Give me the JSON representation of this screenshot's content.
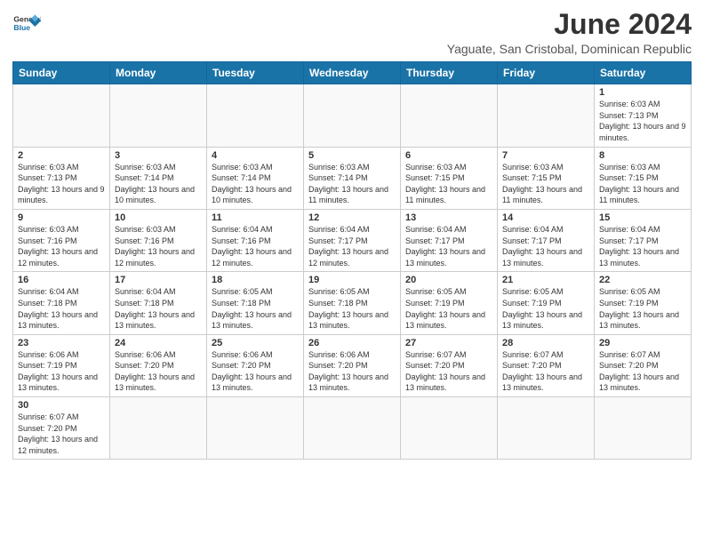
{
  "header": {
    "logo_general": "General",
    "logo_blue": "Blue",
    "month_title": "June 2024",
    "subtitle": "Yaguate, San Cristobal, Dominican Republic"
  },
  "days_of_week": [
    "Sunday",
    "Monday",
    "Tuesday",
    "Wednesday",
    "Thursday",
    "Friday",
    "Saturday"
  ],
  "weeks": [
    [
      {
        "day": "",
        "info": ""
      },
      {
        "day": "",
        "info": ""
      },
      {
        "day": "",
        "info": ""
      },
      {
        "day": "",
        "info": ""
      },
      {
        "day": "",
        "info": ""
      },
      {
        "day": "",
        "info": ""
      },
      {
        "day": "1",
        "info": "Sunrise: 6:03 AM\nSunset: 7:13 PM\nDaylight: 13 hours and 9 minutes."
      }
    ],
    [
      {
        "day": "2",
        "info": "Sunrise: 6:03 AM\nSunset: 7:13 PM\nDaylight: 13 hours and 9 minutes."
      },
      {
        "day": "3",
        "info": "Sunrise: 6:03 AM\nSunset: 7:14 PM\nDaylight: 13 hours and 10 minutes."
      },
      {
        "day": "4",
        "info": "Sunrise: 6:03 AM\nSunset: 7:14 PM\nDaylight: 13 hours and 10 minutes."
      },
      {
        "day": "5",
        "info": "Sunrise: 6:03 AM\nSunset: 7:14 PM\nDaylight: 13 hours and 11 minutes."
      },
      {
        "day": "6",
        "info": "Sunrise: 6:03 AM\nSunset: 7:15 PM\nDaylight: 13 hours and 11 minutes."
      },
      {
        "day": "7",
        "info": "Sunrise: 6:03 AM\nSunset: 7:15 PM\nDaylight: 13 hours and 11 minutes."
      },
      {
        "day": "8",
        "info": "Sunrise: 6:03 AM\nSunset: 7:15 PM\nDaylight: 13 hours and 11 minutes."
      }
    ],
    [
      {
        "day": "9",
        "info": "Sunrise: 6:03 AM\nSunset: 7:16 PM\nDaylight: 13 hours and 12 minutes."
      },
      {
        "day": "10",
        "info": "Sunrise: 6:03 AM\nSunset: 7:16 PM\nDaylight: 13 hours and 12 minutes."
      },
      {
        "day": "11",
        "info": "Sunrise: 6:04 AM\nSunset: 7:16 PM\nDaylight: 13 hours and 12 minutes."
      },
      {
        "day": "12",
        "info": "Sunrise: 6:04 AM\nSunset: 7:17 PM\nDaylight: 13 hours and 12 minutes."
      },
      {
        "day": "13",
        "info": "Sunrise: 6:04 AM\nSunset: 7:17 PM\nDaylight: 13 hours and 13 minutes."
      },
      {
        "day": "14",
        "info": "Sunrise: 6:04 AM\nSunset: 7:17 PM\nDaylight: 13 hours and 13 minutes."
      },
      {
        "day": "15",
        "info": "Sunrise: 6:04 AM\nSunset: 7:17 PM\nDaylight: 13 hours and 13 minutes."
      }
    ],
    [
      {
        "day": "16",
        "info": "Sunrise: 6:04 AM\nSunset: 7:18 PM\nDaylight: 13 hours and 13 minutes."
      },
      {
        "day": "17",
        "info": "Sunrise: 6:04 AM\nSunset: 7:18 PM\nDaylight: 13 hours and 13 minutes."
      },
      {
        "day": "18",
        "info": "Sunrise: 6:05 AM\nSunset: 7:18 PM\nDaylight: 13 hours and 13 minutes."
      },
      {
        "day": "19",
        "info": "Sunrise: 6:05 AM\nSunset: 7:18 PM\nDaylight: 13 hours and 13 minutes."
      },
      {
        "day": "20",
        "info": "Sunrise: 6:05 AM\nSunset: 7:19 PM\nDaylight: 13 hours and 13 minutes."
      },
      {
        "day": "21",
        "info": "Sunrise: 6:05 AM\nSunset: 7:19 PM\nDaylight: 13 hours and 13 minutes."
      },
      {
        "day": "22",
        "info": "Sunrise: 6:05 AM\nSunset: 7:19 PM\nDaylight: 13 hours and 13 minutes."
      }
    ],
    [
      {
        "day": "23",
        "info": "Sunrise: 6:06 AM\nSunset: 7:19 PM\nDaylight: 13 hours and 13 minutes."
      },
      {
        "day": "24",
        "info": "Sunrise: 6:06 AM\nSunset: 7:20 PM\nDaylight: 13 hours and 13 minutes."
      },
      {
        "day": "25",
        "info": "Sunrise: 6:06 AM\nSunset: 7:20 PM\nDaylight: 13 hours and 13 minutes."
      },
      {
        "day": "26",
        "info": "Sunrise: 6:06 AM\nSunset: 7:20 PM\nDaylight: 13 hours and 13 minutes."
      },
      {
        "day": "27",
        "info": "Sunrise: 6:07 AM\nSunset: 7:20 PM\nDaylight: 13 hours and 13 minutes."
      },
      {
        "day": "28",
        "info": "Sunrise: 6:07 AM\nSunset: 7:20 PM\nDaylight: 13 hours and 13 minutes."
      },
      {
        "day": "29",
        "info": "Sunrise: 6:07 AM\nSunset: 7:20 PM\nDaylight: 13 hours and 13 minutes."
      }
    ],
    [
      {
        "day": "30",
        "info": "Sunrise: 6:07 AM\nSunset: 7:20 PM\nDaylight: 13 hours and 12 minutes."
      },
      {
        "day": "",
        "info": ""
      },
      {
        "day": "",
        "info": ""
      },
      {
        "day": "",
        "info": ""
      },
      {
        "day": "",
        "info": ""
      },
      {
        "day": "",
        "info": ""
      },
      {
        "day": "",
        "info": ""
      }
    ]
  ]
}
